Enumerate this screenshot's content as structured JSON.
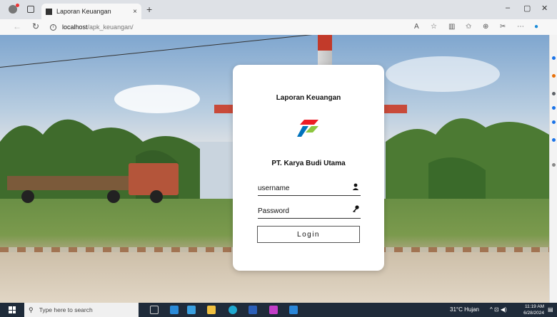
{
  "browser": {
    "tab_title": "Laporan Keuangan",
    "tab_close": "×",
    "new_tab": "+",
    "url_host": "localhost",
    "url_path": "/apk_keuangan/",
    "minimize": "–",
    "maximize": "▢",
    "close": "✕"
  },
  "login": {
    "title": "Laporan Keuangan",
    "company": "PT. Karya Budi Utama",
    "username_placeholder": "username",
    "password_placeholder": "Password",
    "login_label": "Login",
    "logo_colors": [
      "#ed1c24",
      "#0072bc",
      "#8dc63f"
    ]
  },
  "taskbar": {
    "search_placeholder": "Type here to search",
    "weather": "31°C  Hujan",
    "time": "11:19 AM",
    "date": "6/28/2024"
  }
}
